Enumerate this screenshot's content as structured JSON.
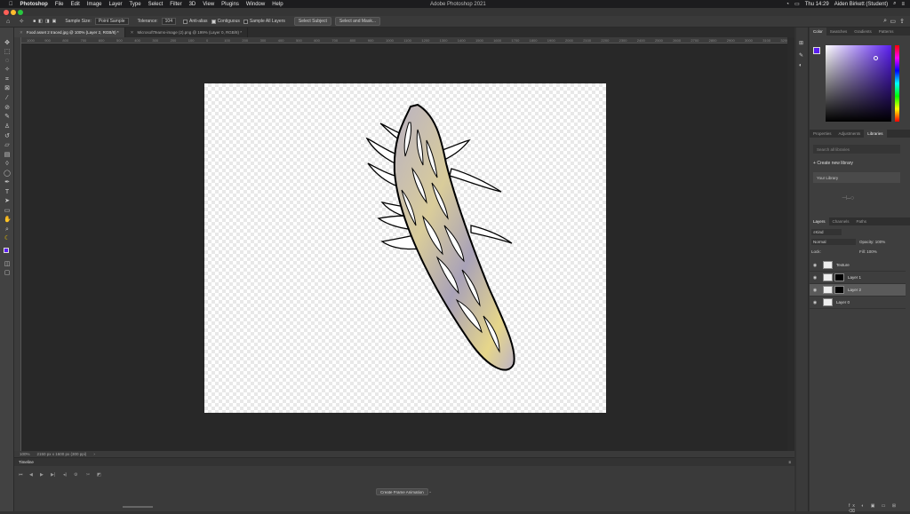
{
  "menubar": {
    "app": "Photoshop",
    "items": [
      "File",
      "Edit",
      "Image",
      "Layer",
      "Type",
      "Select",
      "Filter",
      "3D",
      "View",
      "Plugins",
      "Window",
      "Help"
    ],
    "window_title": "Adobe Photoshop 2021",
    "clock": "Thu 14:29",
    "user": "Aiden Birkett (Student)"
  },
  "options": {
    "sample_size_label": "Sample Size:",
    "sample_size_value": "Point Sample",
    "tolerance_label": "Tolerance:",
    "tolerance_value": "104",
    "anti_alias": "Anti-alias",
    "contiguous": "Contiguous",
    "sample_all_layers": "Sample All Layers",
    "select_subject": "Select Subject",
    "select_and_mask": "Select and Mask..."
  },
  "tabs": [
    {
      "label": "Food asset 2 traced.jpg @ 100% (Layer 2, RGB/8) *"
    },
    {
      "label": "MicrosoftTeams-image (2).png @ 199% (Layer 0, RGB/8) *"
    }
  ],
  "ruler": [
    "1000",
    "900",
    "800",
    "700",
    "600",
    "500",
    "400",
    "300",
    "200",
    "100",
    "0",
    "100",
    "200",
    "300",
    "400",
    "500",
    "600",
    "700",
    "800",
    "900",
    "1000",
    "1100",
    "1200",
    "1300",
    "1400",
    "1500",
    "1600",
    "1700",
    "1800",
    "1900",
    "2000",
    "2100",
    "2200",
    "2300",
    "2400",
    "2500",
    "2600",
    "2700",
    "2800",
    "2900",
    "3000",
    "3100",
    "3200"
  ],
  "status": {
    "zoom": "100%",
    "dims": "2150 px x 1600 px (300 ppi)"
  },
  "timeline": {
    "title": "Timeline",
    "create_btn": "Create Frame Animation"
  },
  "color_panel": {
    "tabs": [
      "Color",
      "Swatches",
      "Gradients",
      "Patterns"
    ],
    "accent": "#5a1ef0"
  },
  "libraries_panel": {
    "tabs": [
      "Properties",
      "Adjustments",
      "Libraries"
    ],
    "search_placeholder": "Search all libraries",
    "create_new": "Create new library",
    "your_library": "Your Library"
  },
  "layers_panel": {
    "tabs": [
      "Layers",
      "Channels",
      "Paths"
    ],
    "kind": "Kind",
    "blend_mode": "Normal",
    "opacity_label": "Opacity:",
    "opacity": "100%",
    "lock_label": "Lock:",
    "fill_label": "Fill:",
    "fill": "100%",
    "layers": [
      {
        "name": "Texture",
        "selected": false,
        "mask": false
      },
      {
        "name": "Layer 1",
        "selected": false,
        "mask": true
      },
      {
        "name": "Layer 2",
        "selected": true,
        "mask": true
      },
      {
        "name": "Layer 0",
        "selected": false,
        "mask": false
      }
    ]
  }
}
